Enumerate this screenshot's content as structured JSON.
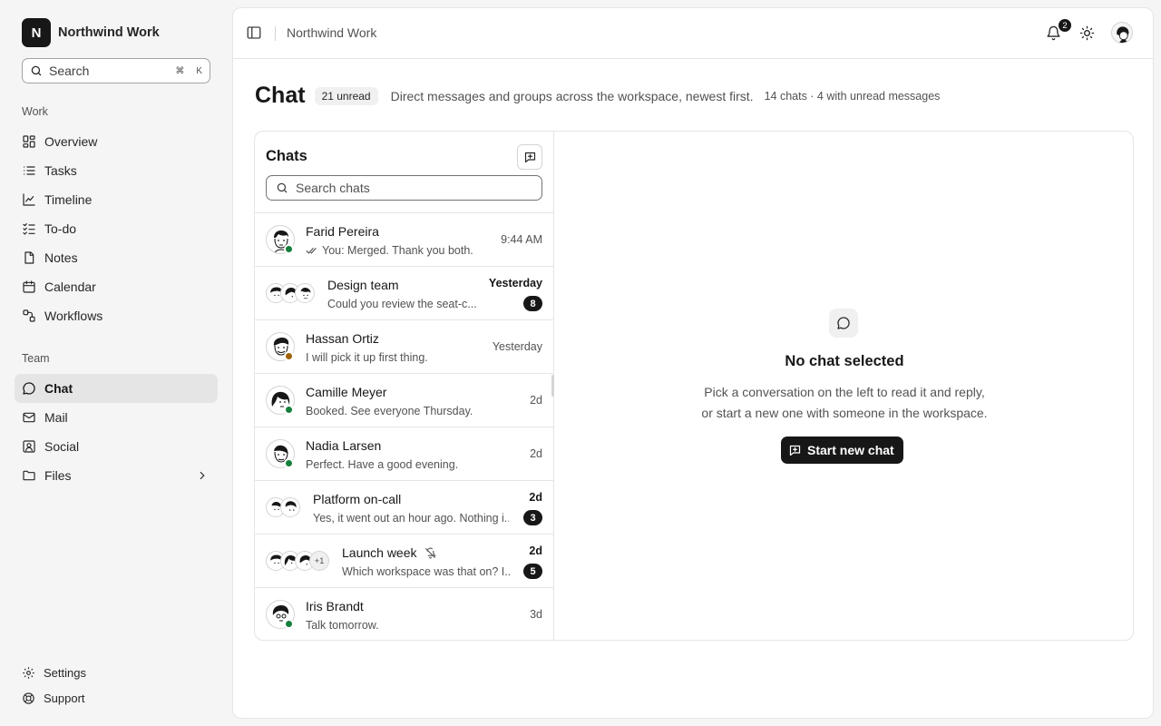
{
  "brand": {
    "initial": "N",
    "name": "Northwind Work"
  },
  "sidebar": {
    "search_placeholder": "Search",
    "search_shortcut_cmd": "⌘",
    "search_shortcut_key": "K",
    "work_label": "Work",
    "work_items": [
      {
        "label": "Overview",
        "icon": "grid-icon"
      },
      {
        "label": "Tasks",
        "icon": "list-icon"
      },
      {
        "label": "Timeline",
        "icon": "chart-line-icon"
      },
      {
        "label": "To-do",
        "icon": "checklist-icon"
      },
      {
        "label": "Notes",
        "icon": "note-icon"
      },
      {
        "label": "Calendar",
        "icon": "calendar-icon"
      },
      {
        "label": "Workflows",
        "icon": "workflow-icon"
      }
    ],
    "team_label": "Team",
    "team_items": [
      {
        "label": "Chat",
        "icon": "chat-bubble-icon",
        "active": true
      },
      {
        "label": "Mail",
        "icon": "mail-icon"
      },
      {
        "label": "Social",
        "icon": "social-icon"
      },
      {
        "label": "Files",
        "icon": "folder-icon"
      }
    ],
    "footer": {
      "settings": "Settings",
      "support": "Support"
    }
  },
  "topbar": {
    "breadcrumb": "Northwind Work",
    "notifications_count": "2"
  },
  "page": {
    "title": "Chat",
    "unread_badge": "21 unread",
    "description": "Direct messages and groups across the workspace, newest first.",
    "meta": "14 chats · 4 with unread messages"
  },
  "chat_list": {
    "title": "Chats",
    "search_placeholder": "Search chats",
    "rows": [
      {
        "name": "Farid Pereira",
        "preview": "You: Merged. Thank you both.",
        "time": "9:44 AM",
        "status": "online",
        "read_receipt": true
      },
      {
        "name": "Design team",
        "preview": "Could you review the seat-c...",
        "time": "Yesterday",
        "unread": "8",
        "group": 3
      },
      {
        "name": "Hassan Ortiz",
        "preview": "I will pick it up first thing.",
        "time": "Yesterday",
        "status": "away"
      },
      {
        "name": "Camille Meyer",
        "preview": "Booked. See everyone Thursday.",
        "time": "2d",
        "status": "online"
      },
      {
        "name": "Nadia Larsen",
        "preview": "Perfect. Have a good evening.",
        "time": "2d",
        "status": "online"
      },
      {
        "name": "Platform on-call",
        "preview": "Yes, it went out an hour ago. Nothing i...",
        "time": "2d",
        "unread": "3",
        "group": 2
      },
      {
        "name": "Launch week",
        "preview": "Which workspace was that on? I...",
        "time": "2d",
        "unread": "5",
        "group": 3,
        "extra_members": "+1",
        "muted": true
      },
      {
        "name": "Iris Brandt",
        "preview": "Talk tomorrow.",
        "time": "3d",
        "status": "online"
      }
    ]
  },
  "empty_state": {
    "title": "No chat selected",
    "line1": "Pick a conversation on the left to read it and reply,",
    "line2": "or start a new one with someone in the workspace.",
    "button": "Start new chat"
  },
  "colors": {
    "online": "#15803d",
    "away": "#a16207",
    "accent": "#171717"
  }
}
